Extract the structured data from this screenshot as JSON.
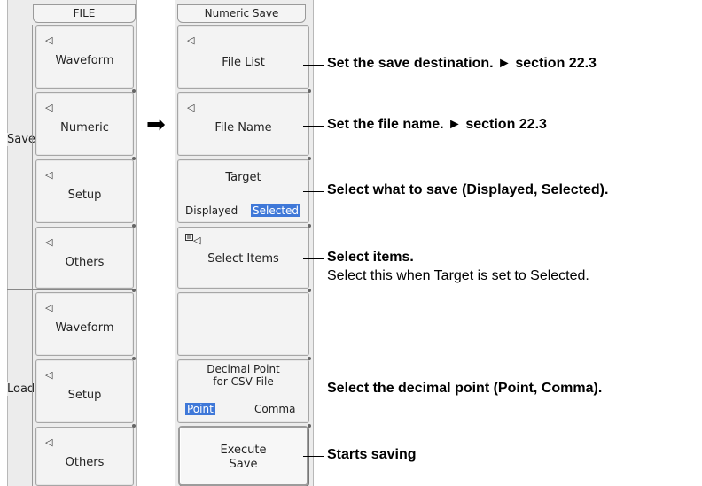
{
  "file_menu": {
    "title": "FILE",
    "save_group": "Save",
    "load_group": "Load",
    "save_items": [
      "Waveform",
      "Numeric",
      "Setup",
      "Others"
    ],
    "load_items": [
      "Waveform",
      "Setup",
      "Others"
    ]
  },
  "numeric_save_menu": {
    "title": "Numeric Save",
    "file_list": "File List",
    "file_name": "File Name",
    "target": {
      "label": "Target",
      "options": [
        "Displayed",
        "Selected"
      ],
      "selected": "Selected"
    },
    "select_items": "Select Items",
    "decimal_point": {
      "label_line1": "Decimal Point",
      "label_line2": "for CSV File",
      "options": [
        "Point",
        "Comma"
      ],
      "selected": "Point"
    },
    "execute": {
      "line1": "Execute",
      "line2": "Save"
    }
  },
  "annotations": {
    "file_list": "Set the save destination. ► section 22.3",
    "file_name": "Set the file name. ► section 22.3",
    "target": "Select what to save (Displayed, Selected).",
    "select_items": "Select items.",
    "select_items_note": "Select this when Target is set to Selected.",
    "decimal_point": "Select the decimal point (Point, Comma).",
    "execute": "Starts saving"
  },
  "icons": {
    "softkey_indicator": "◁",
    "navigate_arrow": "➡",
    "select_items_icon": "list-icon"
  },
  "colors": {
    "highlight": "#3f78d8"
  }
}
